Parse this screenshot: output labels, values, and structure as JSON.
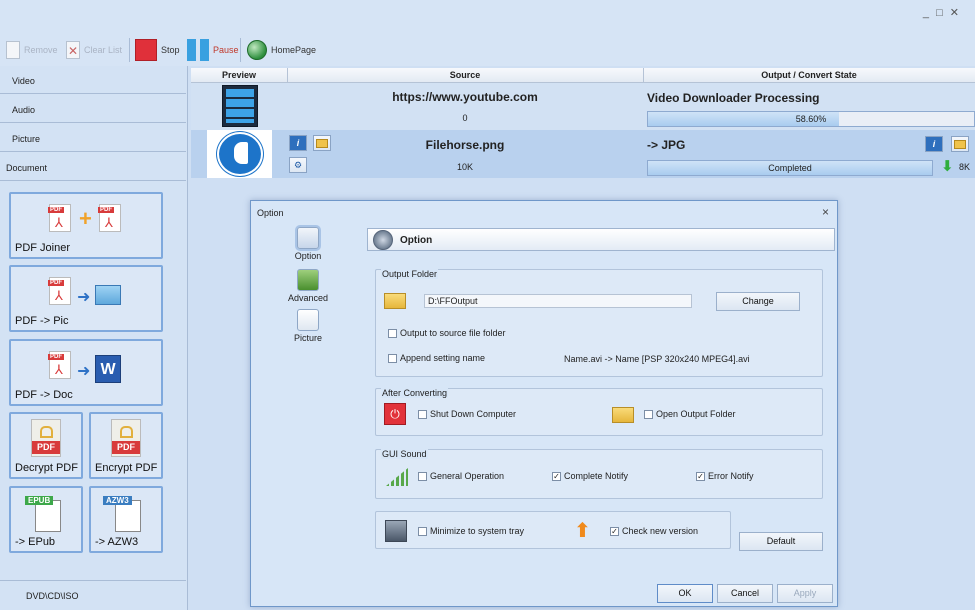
{
  "window": {
    "controls": "_ □ ✕"
  },
  "toolbar": {
    "remove": "Remove",
    "clear_list": "Clear List",
    "stop": "Stop",
    "pause": "Pause",
    "homepage": "HomePage"
  },
  "sidebar": {
    "categories": [
      "Video",
      "Audio",
      "Picture",
      "Document"
    ],
    "tiles": [
      "PDF Joiner",
      "PDF -> Pic",
      "PDF -> Doc",
      "Decrypt PDF",
      "Encrypt PDF",
      "-> EPub",
      "-> AZW3"
    ],
    "tags": {
      "epub": "EPUB",
      "azw3": "AZW3",
      "pdf": "PDF",
      "word": "W"
    },
    "bottom": "DVD\\CD\\ISO"
  },
  "list": {
    "columns": [
      "Preview",
      "Source",
      "Output / Convert State"
    ],
    "rows": [
      {
        "source": "https://www.youtube.com",
        "size": "0",
        "state": "Video Downloader Processing",
        "progress_label": "58.60%",
        "progress": 0.586
      },
      {
        "source": "Filehorse.png",
        "size": "10K",
        "state": "-> JPG",
        "progress_label": "Completed",
        "progress": 1.0,
        "out_size": "8K"
      }
    ],
    "icons": {
      "info": "i",
      "gear": "⚙",
      "download": "⬇"
    }
  },
  "dialog": {
    "title": "Option",
    "close": "×",
    "nav": [
      "Option",
      "Advanced",
      "Picture"
    ],
    "section_title": "Option",
    "output_folder": {
      "title": "Output Folder",
      "path": "D:\\FFOutput",
      "change": "Change",
      "to_source": "Output to source file folder",
      "append_name": "Append setting name",
      "append_example": "Name.avi  -> Name [PSP 320x240 MPEG4].avi"
    },
    "after_converting": {
      "title": "After Converting",
      "shutdown": "Shut Down Computer",
      "open_folder": "Open Output Folder",
      "power_glyph": "⏻"
    },
    "gui_sound": {
      "title": "GUI Sound",
      "general": "General Operation",
      "complete": "Complete Notify",
      "error": "Error Notify"
    },
    "misc": {
      "minimize": "Minimize to system tray",
      "check_version": "Check new version"
    },
    "buttons": {
      "default": "Default",
      "ok": "OK",
      "cancel": "Cancel",
      "apply": "Apply"
    },
    "check_glyph": "✓"
  }
}
